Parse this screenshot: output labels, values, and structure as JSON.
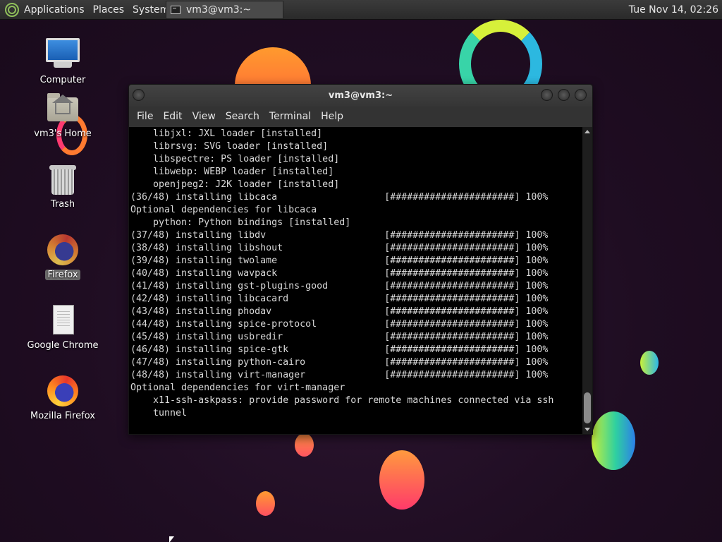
{
  "panel": {
    "menus": [
      "Applications",
      "Places",
      "System"
    ],
    "task_title": "vm3@vm3:~",
    "clock": "Tue Nov 14, 02:26"
  },
  "desktop": {
    "icons": [
      {
        "label": "Computer",
        "icon": "computer-icon"
      },
      {
        "label": "vm3's Home",
        "icon": "home-folder-icon"
      },
      {
        "label": "Trash",
        "icon": "trash-icon"
      },
      {
        "label": "Firefox",
        "icon": "firefox-icon"
      },
      {
        "label": "Google Chrome",
        "icon": "document-icon"
      },
      {
        "label": "Mozilla Firefox",
        "icon": "firefox-icon"
      }
    ]
  },
  "terminal": {
    "title": "vm3@vm3:~",
    "menus": [
      "File",
      "Edit",
      "View",
      "Search",
      "Terminal",
      "Help"
    ],
    "lines": [
      "    libjxl: JXL loader [installed]",
      "    librsvg: SVG loader [installed]",
      "    libspectre: PS loader [installed]",
      "    libwebp: WEBP loader [installed]",
      "    openjpeg2: J2K loader [installed]",
      "(36/48) installing libcaca                   [######################] 100%",
      "Optional dependencies for libcaca",
      "    python: Python bindings [installed]",
      "(37/48) installing libdv                     [######################] 100%",
      "(38/48) installing libshout                  [######################] 100%",
      "(39/48) installing twolame                   [######################] 100%",
      "(40/48) installing wavpack                   [######################] 100%",
      "(41/48) installing gst-plugins-good          [######################] 100%",
      "(42/48) installing libcacard                 [######################] 100%",
      "(43/48) installing phodav                    [######################] 100%",
      "(44/48) installing spice-protocol            [######################] 100%",
      "(45/48) installing usbredir                  [######################] 100%",
      "(46/48) installing spice-gtk                 [######################] 100%",
      "(47/48) installing python-cairo              [######################] 100%",
      "(48/48) installing virt-manager              [######################] 100%",
      "Optional dependencies for virt-manager",
      "    x11-ssh-askpass: provide password for remote machines connected via ssh",
      "    tunnel"
    ]
  }
}
